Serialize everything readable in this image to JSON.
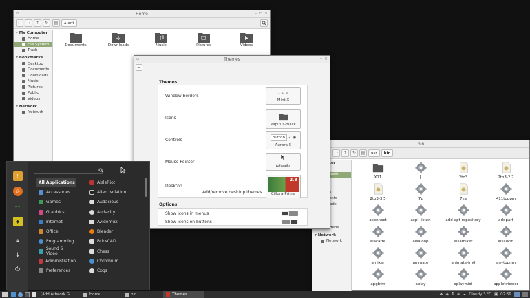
{
  "home_window": {
    "title": "Home",
    "location": "ant",
    "sidebar": {
      "computer_header": "My Computer",
      "computer_items": [
        "Home",
        "File System",
        "Trash"
      ],
      "bookmarks_header": "Bookmarks",
      "bookmark_items": [
        "Desktop",
        "Documents",
        "Downloads",
        "Music",
        "Pictures",
        "Public",
        "Videos"
      ],
      "network_header": "Network",
      "network_items": [
        "Network"
      ]
    },
    "folders": [
      "Documents",
      "Downloads",
      "Music",
      "Pictures",
      "Videos"
    ]
  },
  "themes_window": {
    "title": "Themes",
    "section_themes": "Themes",
    "rows": [
      {
        "label": "Window borders",
        "preview": "Mint-X"
      },
      {
        "label": "Icons",
        "preview": "Papirus-Black"
      },
      {
        "label": "Controls",
        "preview": "Aurora-5"
      },
      {
        "label": "Mouse Pointer",
        "preview": "Adwaita"
      },
      {
        "label": "Desktop",
        "preview": "Cillora-Prima"
      }
    ],
    "controls_button": "Button",
    "desktop_badge": "2.8",
    "add_remove_link": "Add/remove desktop themes...",
    "section_options": "Options",
    "options": [
      {
        "label": "Show icons in menus",
        "state": "on"
      },
      {
        "label": "Show icons on buttons",
        "state": "off"
      }
    ]
  },
  "bin_window": {
    "title": "bin",
    "path": [
      "usr",
      "bin"
    ],
    "sidebar_fragments": [
      "Computer",
      "me",
      "e System",
      "sh",
      "marks",
      "sktop",
      "cuments",
      "wnloads",
      "usic",
      "tures",
      "blic"
    ],
    "sidebar_videos": "Videos",
    "network_header": "Network",
    "network_item": "Network",
    "items": [
      "X11",
      "[",
      "2to3",
      "2to3-2.7",
      "2to3-3.5",
      "7z",
      "7za",
      "411toppm",
      "aconnect",
      "acpi_listen",
      "add-apt-repository",
      "addpart",
      "alacarte",
      "alsaloop",
      "alsamixer",
      "alsaucm",
      "amixer",
      "animate",
      "animate-im6",
      "anytopnm",
      "apgbfm",
      "aplay",
      "aplaymidi",
      "appletviewer"
    ]
  },
  "menu": {
    "search_placeholder": "",
    "categories": [
      "All Applications",
      "Accessories",
      "Games",
      "Graphics",
      "Internet",
      "Office",
      "Programming",
      "Sound & Video",
      "Administration",
      "Preferences"
    ],
    "apps": [
      "AisleRiot",
      "Alien Isolation",
      "Audacious",
      "Audacity",
      "Avidemux",
      "Blender",
      "BricsCAD",
      "Chess",
      "Chromium",
      "Cogs"
    ]
  },
  "taskbar": {
    "items": [
      "[Add  Artwork G...",
      "Home",
      "bin",
      "Themes"
    ],
    "weather": "Cloudy 3 °C",
    "clock": "02:59"
  },
  "colors": {
    "accent": "#8fa876",
    "menu_bg": "#2b2b2b",
    "taskbar_bg": "#2f2f2f"
  }
}
